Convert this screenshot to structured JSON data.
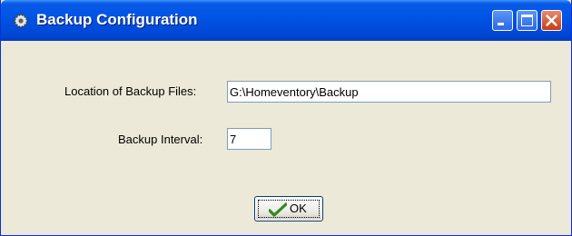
{
  "window": {
    "title": "Backup Configuration",
    "icon": "gear-icon",
    "controls": {
      "minimize": "minimize-icon",
      "maximize": "maximize-icon",
      "close": "close-icon"
    }
  },
  "form": {
    "location_label": "Location of Backup Files:",
    "location_value": "G:\\Homeventory\\Backup",
    "interval_label": "Backup Interval:",
    "interval_value": "7"
  },
  "ok_button": {
    "label": "OK",
    "icon": "checkmark-icon"
  },
  "colors": {
    "titlebar": "#0055E5",
    "dialog_bg": "#ECE9D8",
    "close_button": "#C63C15",
    "check": "#2E8B1E"
  }
}
